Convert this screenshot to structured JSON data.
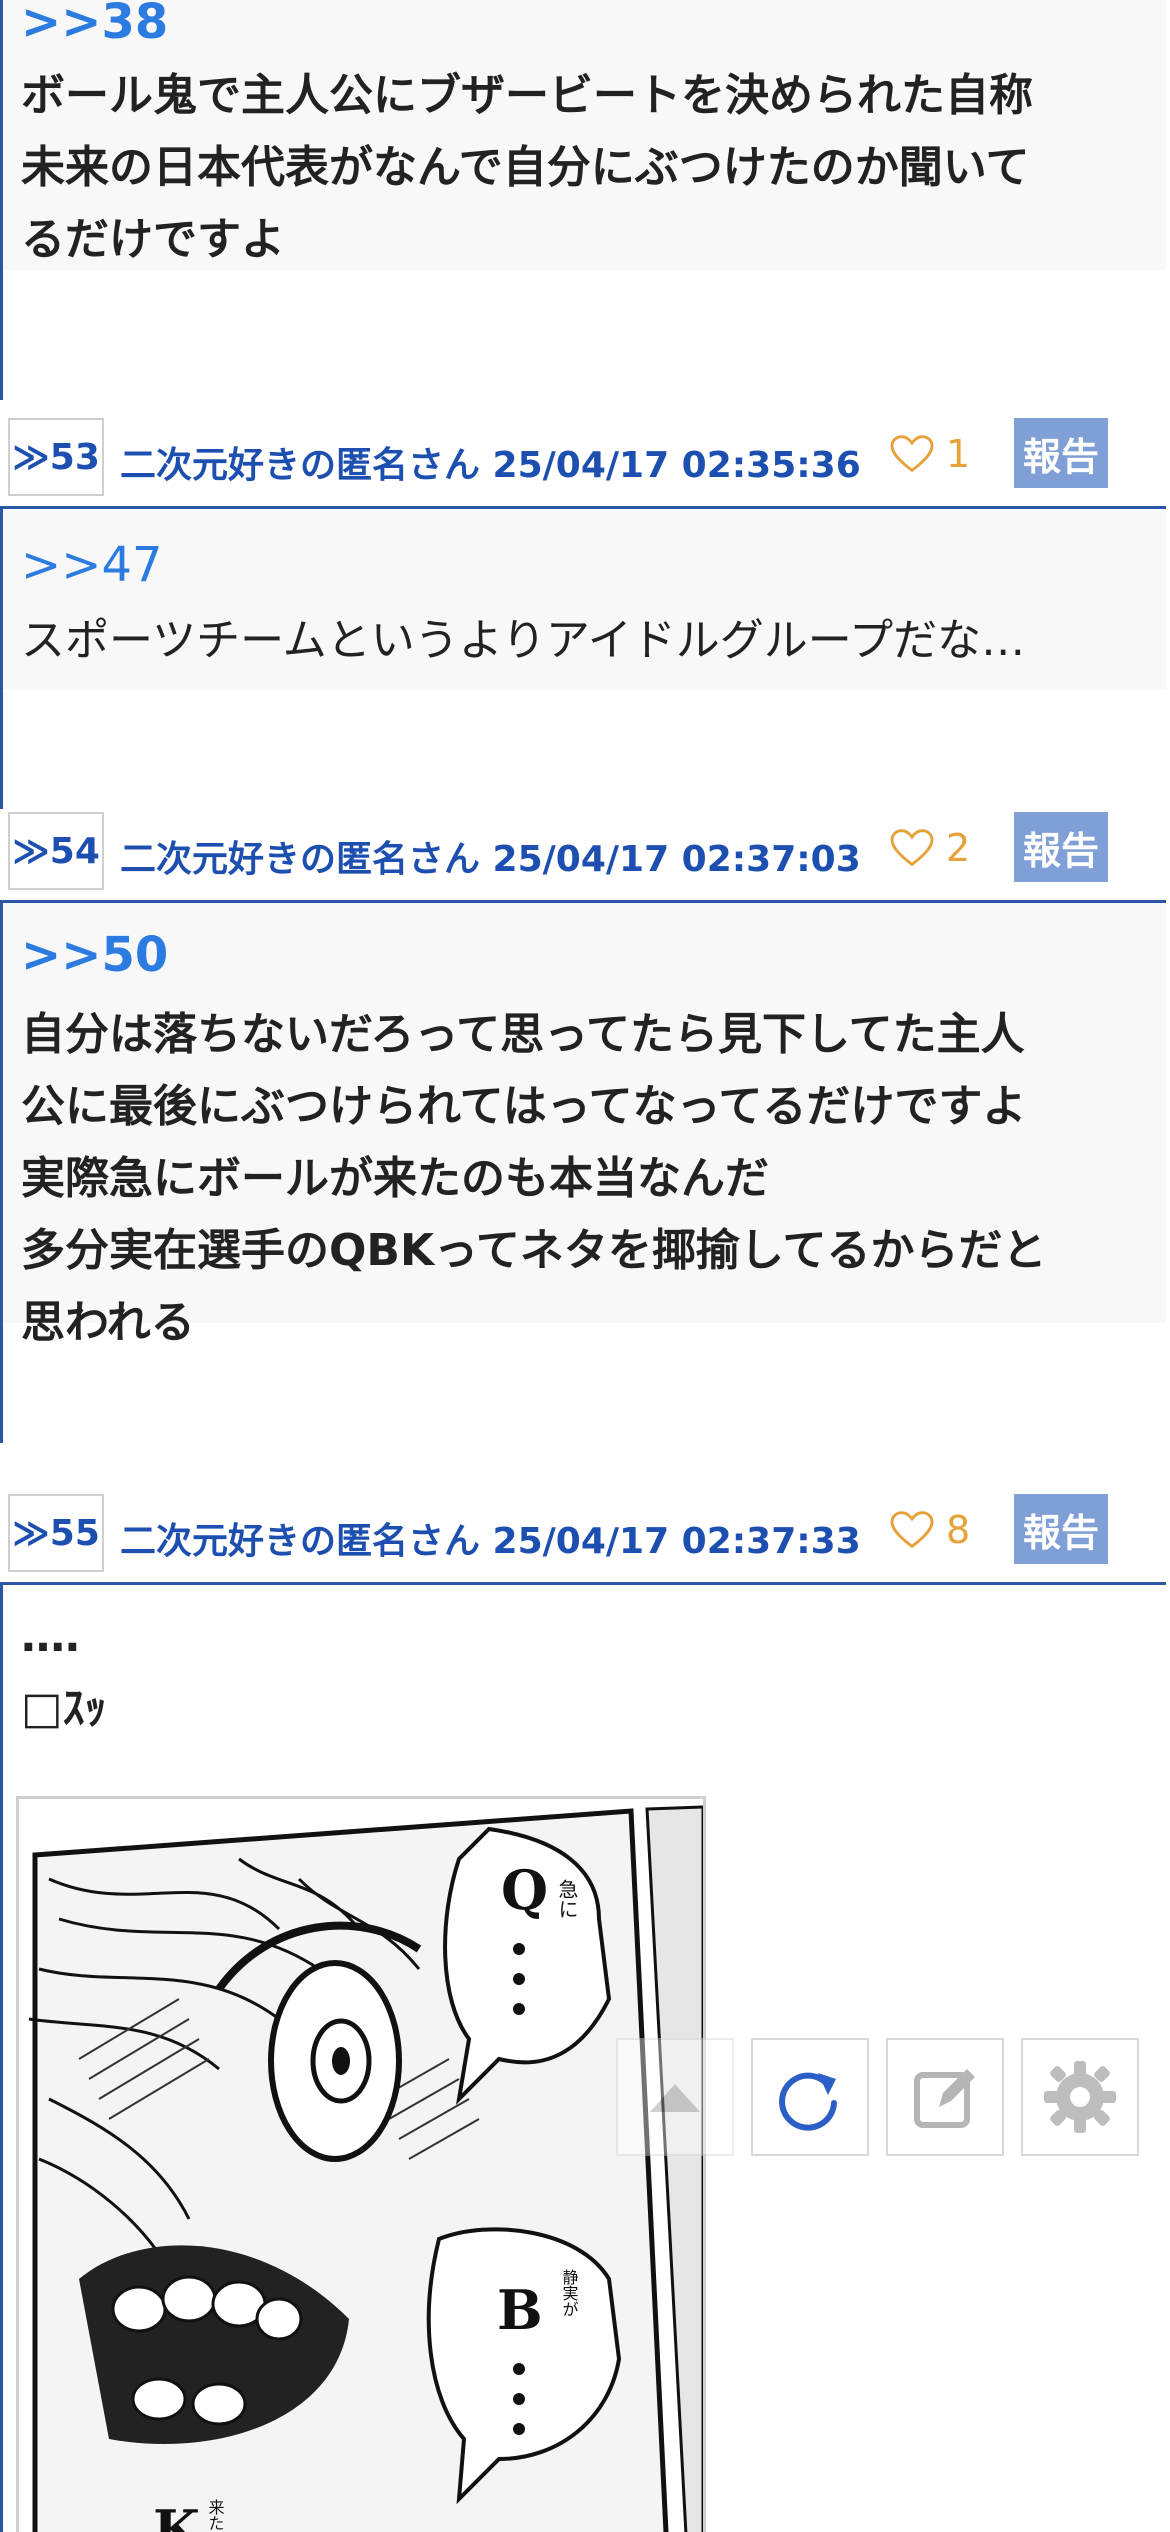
{
  "posts": [
    {
      "anchor": ">>38",
      "text": "ボール鬼で主人公にブザービートを決められた自称\n未来の日本代表がなんで自分にぶつけたのか聞いて\nるだけですよ",
      "bold": true
    },
    {
      "res_number": "≫53",
      "author_datetime": "二次元好きの匿名さん 25/04/17 02:35:36",
      "likes": "1",
      "report_label": "報告",
      "anchor": ">>47",
      "text": "スポーツチームというよりアイドルグループだな…",
      "bold": false
    },
    {
      "res_number": "≫54",
      "author_datetime": "二次元好きの匿名さん 25/04/17 02:37:03",
      "likes": "2",
      "report_label": "報告",
      "anchor": ">>50",
      "text": "自分は落ちないだろって思ってたら見下してた主人\n公に最後にぶつけられてはってなってるだけですよ\n実際急にボールが来たのも本当なんだ\n多分実在選手のQBKってネタを揶揄してるからだと\n思われる",
      "bold": true
    },
    {
      "res_number": "≫55",
      "author_datetime": "二次元好きの匿名さん 25/04/17 02:37:33",
      "likes": "8",
      "report_label": "報告",
      "text": "‥‥\n□ｽｯ",
      "bold": true
    }
  ],
  "manga_text": {
    "q": "Q",
    "q_small": "急に",
    "b": "B",
    "b_small": "静実が",
    "k": "K",
    "k_small": "来たから"
  },
  "fab_icons": [
    "scroll-top-icon",
    "refresh-icon",
    "compose-icon",
    "settings-icon"
  ],
  "colors": {
    "link": "#2b7be0",
    "author": "#1d4fb0",
    "separator": "#2b56a5",
    "like": "#e5a23a",
    "report_bg": "#7f9fd6"
  }
}
